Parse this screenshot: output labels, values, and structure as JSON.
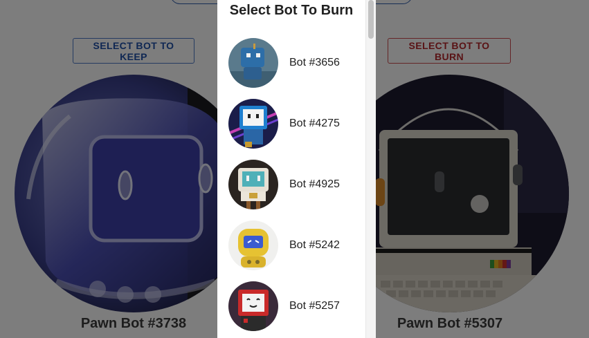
{
  "page": {
    "keep_button_label": "SELECT BOT TO KEEP",
    "burn_button_label": "SELECT BOT TO BURN",
    "keep_bot_name": "Pawn Bot #3738",
    "burn_bot_name": "Pawn Bot #5307"
  },
  "drawer": {
    "title": "Select Bot To Burn",
    "items": [
      {
        "label": "Bot #3656"
      },
      {
        "label": "Bot #4275"
      },
      {
        "label": "Bot #4925"
      },
      {
        "label": "Bot #5242"
      },
      {
        "label": "Bot #5257"
      }
    ]
  },
  "colors": {
    "keep_accent": "#1e4fa6",
    "burn_accent": "#b3262b",
    "overlay": "rgba(0,0,0,0.5)"
  }
}
